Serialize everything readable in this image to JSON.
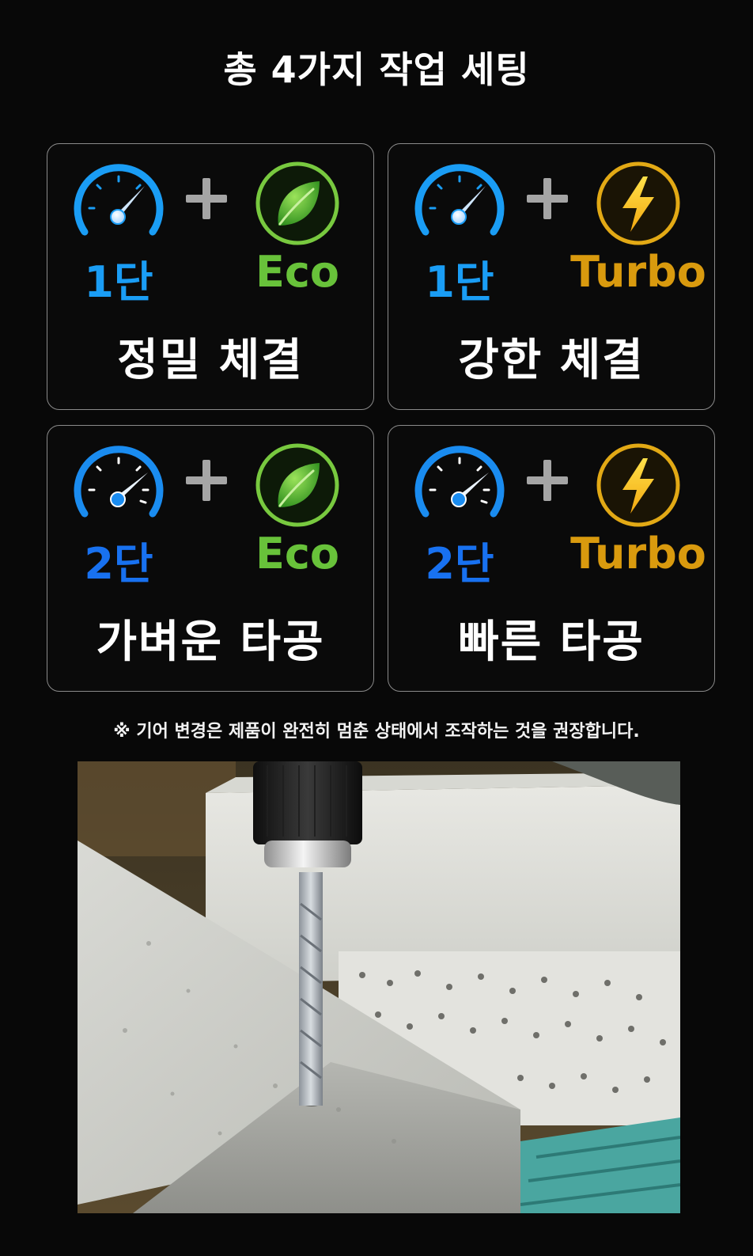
{
  "title": "총 4가지 작업 세팅",
  "colors": {
    "gear1": "#1a9df5",
    "gear2": "#1871f0",
    "eco": "#68c23a",
    "turbo": "#d99a0e"
  },
  "cards": [
    {
      "gear": "1단",
      "mode": "Eco",
      "mode_icon": "leaf-icon",
      "task": "정밀 체결"
    },
    {
      "gear": "1단",
      "mode": "Turbo",
      "mode_icon": "lightning-icon",
      "task": "강한 체결"
    },
    {
      "gear": "2단",
      "mode": "Eco",
      "mode_icon": "leaf-icon",
      "task": "가벼운 타공"
    },
    {
      "gear": "2단",
      "mode": "Turbo",
      "mode_icon": "lightning-icon",
      "task": "빠른 타공"
    }
  ],
  "note": "※ 기어 변경은 제품이 완전히 멈춘 상태에서 조작하는 것을 권장합니다."
}
